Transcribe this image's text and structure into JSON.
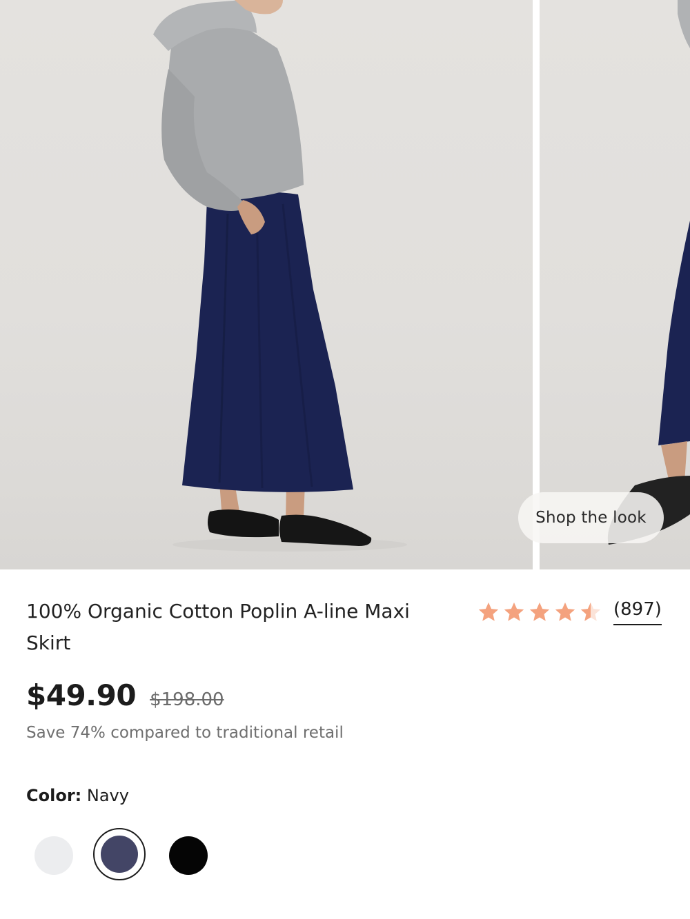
{
  "gallery": {
    "shop_the_look_label": "Shop the look"
  },
  "product": {
    "title": "100% Organic Cotton Poplin A-line Maxi Skirt",
    "rating": 4.5,
    "rating_max": 5,
    "review_count": "(897)",
    "price": "$49.90",
    "original_price": "$198.00",
    "savings_text": "Save 74% compared to traditional retail",
    "color_label": "Color:",
    "selected_color": "Navy",
    "swatches": [
      {
        "name": "White",
        "color": "#ecedef"
      },
      {
        "name": "Navy",
        "color": "#434566",
        "selected": true
      },
      {
        "name": "Black",
        "color": "#050505"
      }
    ],
    "star_color": "#f4a27e"
  }
}
